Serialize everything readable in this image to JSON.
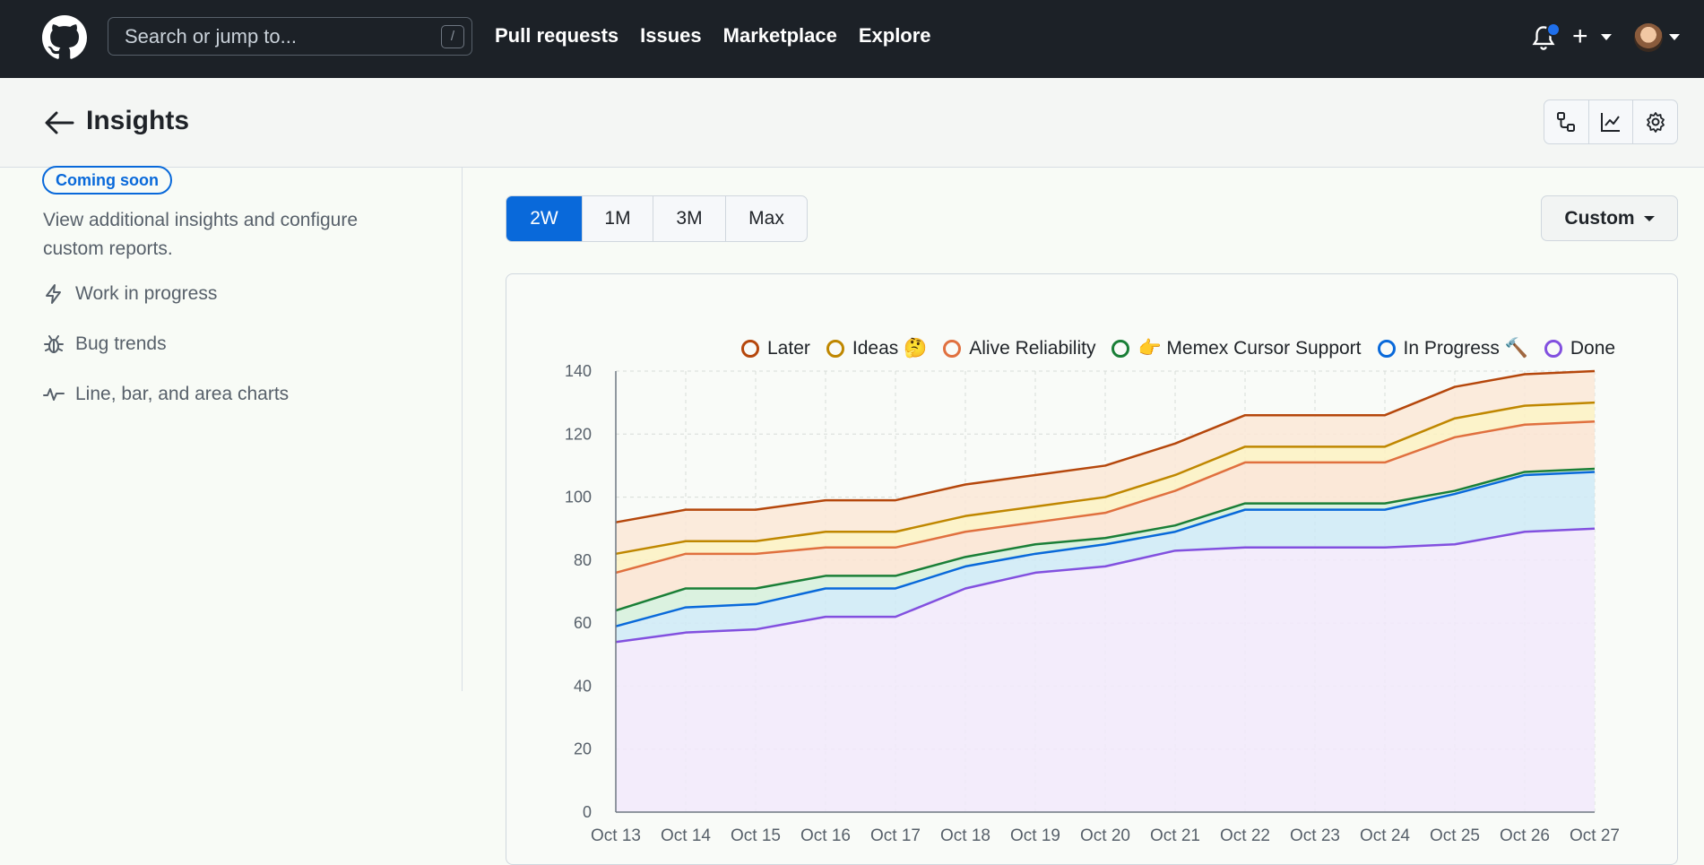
{
  "topnav": {
    "search_placeholder": "Search or jump to...",
    "search_shortcut": "/",
    "links": [
      "Pull requests",
      "Issues",
      "Marketplace",
      "Explore"
    ],
    "plus_label": "+"
  },
  "header": {
    "title": "Insights"
  },
  "sidebar": {
    "badge": "Coming soon",
    "description": "View additional insights and configure custom reports.",
    "items": [
      {
        "label": "Work in progress",
        "icon": "zap-icon"
      },
      {
        "label": "Bug trends",
        "icon": "bug-icon"
      },
      {
        "label": "Line, bar, and area charts",
        "icon": "graph-icon"
      }
    ]
  },
  "range": {
    "options": [
      "2W",
      "1M",
      "3M",
      "Max"
    ],
    "selected": "2W",
    "custom_label": "Custom"
  },
  "colors": {
    "accent": "#0969da",
    "Later": "#b5470c",
    "Ideas": "#bf8700",
    "Alive Reliability": "#e0703f",
    "Memex Cursor Support": "#1a7f37",
    "In Progress": "#0969da",
    "Done": "#8250df"
  },
  "chart_data": {
    "type": "area",
    "stacked": true,
    "categories": [
      "Oct 13",
      "Oct 14",
      "Oct 15",
      "Oct 16",
      "Oct 17",
      "Oct 18",
      "Oct 19",
      "Oct 20",
      "Oct 21",
      "Oct 22",
      "Oct 23",
      "Oct 24",
      "Oct 25",
      "Oct 26",
      "Oct 27"
    ],
    "ylim": [
      0,
      140
    ],
    "yticks": [
      0,
      20,
      40,
      60,
      80,
      100,
      120,
      140
    ],
    "grid": true,
    "legend_position": "top",
    "series": [
      {
        "name": "Done",
        "values": [
          54,
          57,
          58,
          62,
          62,
          71,
          76,
          78,
          83,
          84,
          84,
          84,
          85,
          89,
          90
        ]
      },
      {
        "name": "In Progress 🔨",
        "values": [
          5,
          8,
          8,
          9,
          9,
          7,
          6,
          7,
          6,
          12,
          12,
          12,
          16,
          18,
          18
        ]
      },
      {
        "name": "👉 Memex Cursor Support",
        "values": [
          5,
          6,
          5,
          4,
          4,
          3,
          3,
          2,
          2,
          2,
          2,
          2,
          1,
          1,
          1
        ]
      },
      {
        "name": "Alive Reliability",
        "values": [
          12,
          11,
          11,
          9,
          9,
          8,
          7,
          8,
          11,
          13,
          13,
          13,
          17,
          15,
          15
        ]
      },
      {
        "name": "Ideas 🤔",
        "values": [
          6,
          4,
          4,
          5,
          5,
          5,
          5,
          5,
          5,
          5,
          5,
          5,
          6,
          6,
          6
        ]
      },
      {
        "name": "Later",
        "values": [
          10,
          10,
          10,
          10,
          10,
          10,
          10,
          10,
          10,
          10,
          10,
          10,
          10,
          10,
          10
        ]
      }
    ],
    "legend_order": [
      "Later",
      "Ideas 🤔",
      "Alive Reliability",
      "👉 Memex Cursor Support",
      "In Progress 🔨",
      "Done"
    ]
  }
}
